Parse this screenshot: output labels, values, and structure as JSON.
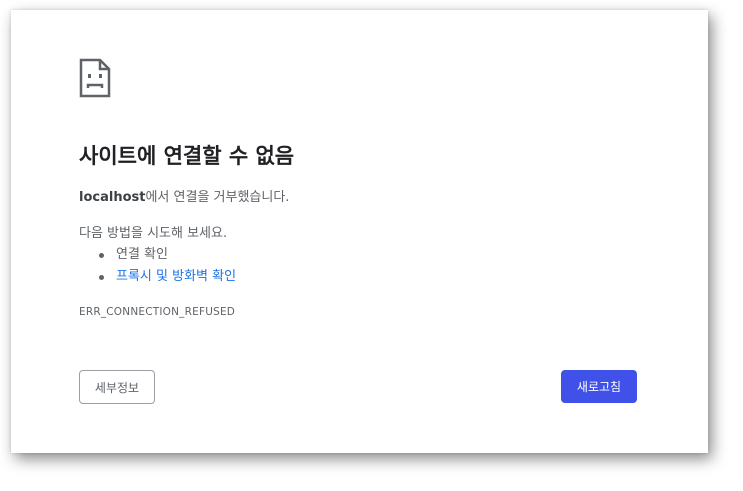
{
  "icon": {
    "name": "sad-page-icon"
  },
  "error": {
    "title": "사이트에 연결할 수 없음",
    "host": "localhost",
    "message_suffix": "에서 연결을 거부했습니다.",
    "suggestions_heading": "다음 방법을 시도해 보세요.",
    "suggestions": [
      {
        "label": "연결 확인"
      },
      {
        "label": "프록시 및 방화벽 확인"
      }
    ],
    "code": "ERR_CONNECTION_REFUSED"
  },
  "buttons": {
    "details_label": "세부정보",
    "reload_label": "새로고침"
  },
  "colors": {
    "link": "#1a73e8",
    "primary_button": "#3f51e8",
    "text": "#5f6368",
    "title": "#202124"
  }
}
